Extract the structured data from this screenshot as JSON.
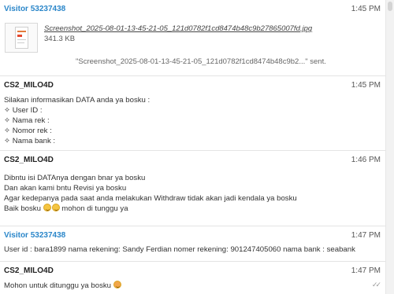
{
  "messages": [
    {
      "author": "Visitor 53237438",
      "time": "1:45 PM",
      "file": {
        "name": "Screenshot_2025-08-01-13-45-21-05_121d0782f1cd8474b48c9b27865007fd.jpg",
        "size": "341.3 KB"
      },
      "sent_note": "\"Screenshot_2025-08-01-13-45-21-05_121d0782f1cd8474b48c9b2...\" sent."
    },
    {
      "author": "CS2_MILO4D",
      "time": "1:45 PM",
      "lines": [
        "Silakan informasikan DATA anda ya bosku :",
        "✧ User ID :",
        "✧ Nama rek :",
        "✧ Nomor rek :",
        "✧ Nama bank :"
      ]
    },
    {
      "author": "CS2_MILO4D",
      "time": "1:46 PM",
      "lines": [
        "Dibntu isi DATAnya dengan bnar ya bosku",
        "Dan akan kami bntu Revisi ya bosku",
        "Agar kedepanya pada saat anda melakukan Withdraw tidak akan jadi kendala ya bosku"
      ],
      "last_line_a": "Baik bosku",
      "last_line_b": "mohon di tunggu ya"
    },
    {
      "author": "Visitor 53237438",
      "time": "1:47 PM",
      "lines": [
        "User id : bara1899 nama rekening: Sandy Ferdian nomer rekening: 901247405060 nama bank : seabank"
      ]
    },
    {
      "author": "CS2_MILO4D",
      "time": "1:47 PM",
      "text": "Mohon untuk ditunggu ya bosku"
    }
  ],
  "colors": {
    "visitor": "#2a86c9",
    "agent": "#222222"
  },
  "icons": {
    "emoji": "smiley-emoji-icon",
    "read": "double-check-icon"
  }
}
